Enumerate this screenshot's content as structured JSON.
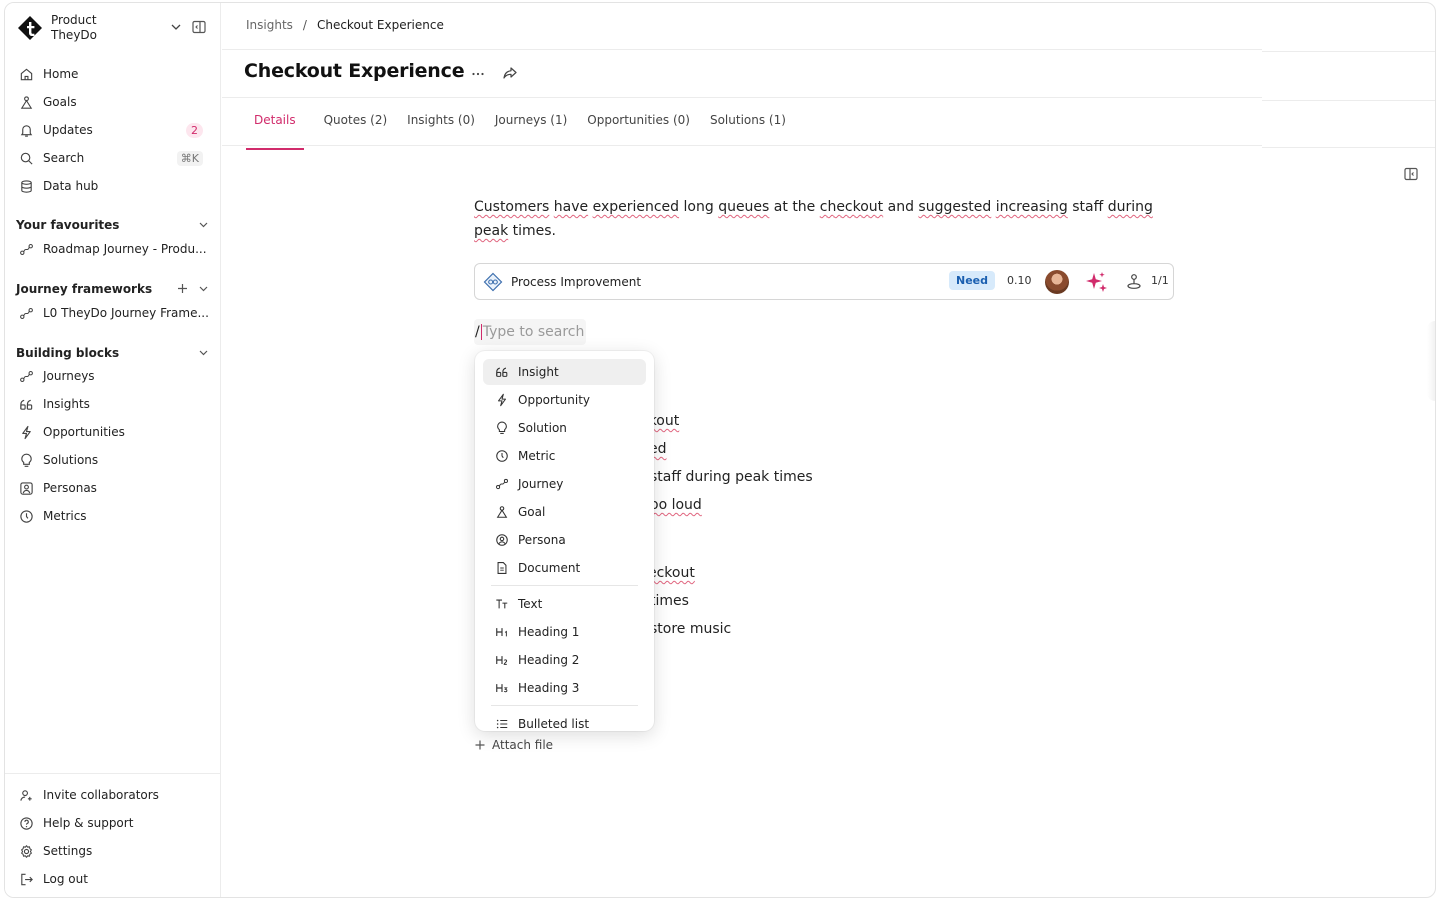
{
  "workspace": {
    "name": "Product",
    "org": "TheyDo"
  },
  "nav": [
    {
      "label": "Home",
      "icon": "home-icon"
    },
    {
      "label": "Goals",
      "icon": "goal-icon"
    },
    {
      "label": "Updates",
      "icon": "bell-icon",
      "badge": "2"
    },
    {
      "label": "Search",
      "icon": "search-icon",
      "shortcut": "⌘K"
    },
    {
      "label": "Data hub",
      "icon": "database-icon"
    }
  ],
  "favourites": {
    "title": "Your favourites",
    "items": [
      {
        "label": "Roadmap Journey - Produ..."
      }
    ]
  },
  "journey_frameworks": {
    "title": "Journey frameworks",
    "items": [
      {
        "label": "L0 TheyDo Journey Frame..."
      }
    ]
  },
  "building_blocks": {
    "title": "Building blocks",
    "items": [
      {
        "label": "Journeys",
        "icon": "journey-icon"
      },
      {
        "label": "Insights",
        "icon": "insight-icon"
      },
      {
        "label": "Opportunities",
        "icon": "bolt-icon"
      },
      {
        "label": "Solutions",
        "icon": "bulb-icon"
      },
      {
        "label": "Personas",
        "icon": "persona-icon"
      },
      {
        "label": "Metrics",
        "icon": "metric-icon"
      }
    ]
  },
  "footer": [
    {
      "label": "Invite collaborators",
      "icon": "invite-icon"
    },
    {
      "label": "Help & support",
      "icon": "help-icon"
    },
    {
      "label": "Settings",
      "icon": "gear-icon"
    },
    {
      "label": "Log out",
      "icon": "logout-icon"
    }
  ],
  "breadcrumb": {
    "parent": "Insights",
    "separator": "/",
    "current": "Checkout Experience"
  },
  "page": {
    "title": "Checkout Experience"
  },
  "tabs": [
    {
      "label": "Details",
      "active": true
    },
    {
      "label": "Quotes (2)"
    },
    {
      "label": "Insights (0)"
    },
    {
      "label": "Journeys (1)"
    },
    {
      "label": "Opportunities (0)"
    },
    {
      "label": "Solutions (1)"
    }
  ],
  "description": {
    "parts": [
      "Customers",
      " ",
      "have",
      " ",
      "experienced",
      " long ",
      "queues",
      " at the ",
      "checkout",
      " and ",
      "suggested",
      " ",
      "increasing",
      " staff ",
      "during",
      " ",
      "peak",
      " times."
    ]
  },
  "need_card": {
    "title": "Process Improvement",
    "badge": "Need",
    "score": "0.10",
    "count": "1/1"
  },
  "slash_input": {
    "slash": "/",
    "placeholder": "Type to search"
  },
  "background_lines": [
    "ckout",
    "ed",
    "staff during peak times",
    "oo loud",
    "eckout",
    "times",
    "store music"
  ],
  "slash_menu": {
    "blocks": [
      {
        "label": "Insight",
        "icon": "insight-icon",
        "selected": true
      },
      {
        "label": "Opportunity",
        "icon": "bolt-icon"
      },
      {
        "label": "Solution",
        "icon": "bulb-icon"
      },
      {
        "label": "Metric",
        "icon": "metric-icon"
      },
      {
        "label": "Journey",
        "icon": "journey-icon"
      },
      {
        "label": "Goal",
        "icon": "goal-icon"
      },
      {
        "label": "Persona",
        "icon": "persona-icon"
      },
      {
        "label": "Document",
        "icon": "document-icon"
      }
    ],
    "text": [
      {
        "label": "Text",
        "icon": "text-icon"
      },
      {
        "label": "Heading 1",
        "icon": "h1-icon"
      },
      {
        "label": "Heading 2",
        "icon": "h2-icon"
      },
      {
        "label": "Heading 3",
        "icon": "h3-icon"
      }
    ],
    "lists": [
      {
        "label": "Bulleted list",
        "icon": "bullet-list-icon"
      }
    ]
  },
  "attach": {
    "label": "Attach file"
  },
  "colors": {
    "accent": "#d12b6b",
    "need_badge_bg": "#d7eafb",
    "need_badge_fg": "#1a5fb0"
  }
}
